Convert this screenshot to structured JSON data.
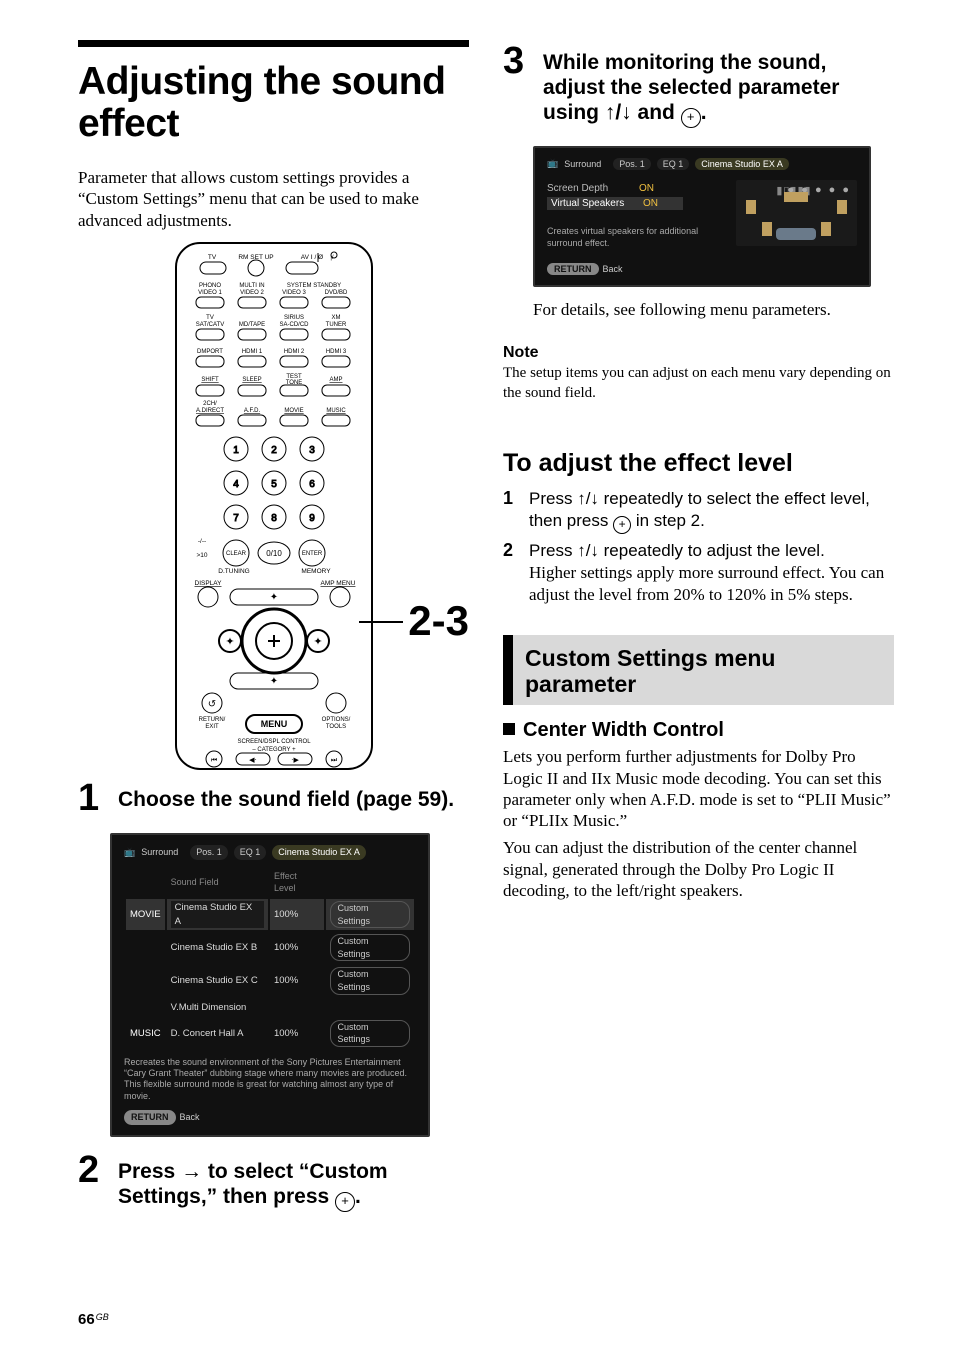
{
  "page_number": "66",
  "page_suffix": "GB",
  "left": {
    "title": "Adjusting the sound effect",
    "intro": "Parameter that allows custom settings provides a “Custom Settings” menu that can be used to make advanced adjustments.",
    "figure_callout": "2-3",
    "remote_labels": {
      "top_row": [
        "TV",
        "RM SET UP",
        "AV Ⅰ / Ø",
        "Ⅰ / Ⅰ"
      ],
      "row2": [
        "PHONO",
        "MULTI IN",
        "SYSTEM STANDBY"
      ],
      "row2b": [
        "VIDEO 1",
        "VIDEO 2",
        "VIDEO 3",
        "DVD/BD"
      ],
      "row3a": [
        "TV",
        "",
        "SIRIUS",
        "XM"
      ],
      "row3b": [
        "SAT/CATV",
        "MD/TAPE",
        "SA-CD/CD",
        "TUNER"
      ],
      "row4": [
        "DMPORT",
        "HDMI 1",
        "HDMI 2",
        "HDMI 3"
      ],
      "row5": [
        "SHIFT",
        "SLEEP",
        "TEST TONE",
        "AMP"
      ],
      "row6a": [
        "2CH/",
        "",
        "",
        ""
      ],
      "row6b": [
        "A.DIRECT",
        "A.F.D.",
        "MOVIE",
        "MUSIC"
      ],
      "num_side": [
        ">10",
        "CLEAR",
        "0/10",
        "ENTER"
      ],
      "below_num": [
        "D.TUNING",
        "",
        "",
        "MEMORY"
      ],
      "disp_row": [
        "DISPLAY",
        "",
        "",
        "AMP MENU"
      ],
      "bottom": [
        "RETURN/ EXIT",
        "MENU",
        "OPTIONS/ TOOLS"
      ],
      "very_bottom1": "SCREEN/DSPL CONTROL",
      "very_bottom2": "–  CATEGORY  +"
    },
    "steps": [
      {
        "num": "1",
        "text": "Choose the sound field (page 59)."
      },
      {
        "num": "2",
        "text_pre": "Press ",
        "arrow": "→",
        "text_mid": " to select “Custom Settings,” then press ",
        "plus": "+",
        "text_post": "."
      }
    ],
    "menu": {
      "crumbs": [
        "Surround",
        "Pos. 1",
        "EQ 1",
        "Cinema Studio EX A"
      ],
      "headers": [
        "",
        "Sound Field",
        "Effect Level",
        ""
      ],
      "rows": [
        {
          "cat": "MOVIE",
          "name": "Cinema Studio EX A",
          "level": "100%",
          "btn": "Custom Settings",
          "highlight": true
        },
        {
          "cat": "",
          "name": "Cinema Studio EX B",
          "level": "100%",
          "btn": "Custom Settings"
        },
        {
          "cat": "",
          "name": "Cinema Studio EX C",
          "level": "100%",
          "btn": "Custom Settings"
        },
        {
          "cat": "",
          "name": "V.Multi Dimension",
          "level": "",
          "btn": ""
        },
        {
          "cat": "MUSIC",
          "name": "D. Concert Hall A",
          "level": "100%",
          "btn": "Custom Settings"
        }
      ],
      "desc": "Recreates the sound environment of the Sony Pictures Entertainment “Cary Grant Theater” dubbing stage where many movies are produced. This flexible surround mode is great for watching almost any type of movie.",
      "return_label": "RETURN",
      "return_text": "Back"
    }
  },
  "right": {
    "step3": {
      "num": "3",
      "text_pre": "While monitoring the sound, adjust the selected parameter using ",
      "arrows": "↑/↓",
      "text_mid": " and ",
      "plus": "+",
      "text_post": "."
    },
    "param_menu": {
      "crumbs": [
        "Surround",
        "Pos. 1",
        "EQ 1",
        "Cinema Studio EX A"
      ],
      "rows": [
        {
          "label": "Screen Depth",
          "value": "ON"
        },
        {
          "label": "Virtual Speakers",
          "value": "ON",
          "highlight": true
        }
      ],
      "desc": "Creates virtual speakers for additional surround effect.",
      "return_label": "RETURN",
      "return_text": "Back"
    },
    "after_param": "For details, see following menu parameters.",
    "note_head": "Note",
    "note_body": "The setup items you can adjust on each menu vary depending on the sound field.",
    "effect_title": "To adjust the effect level",
    "effect_steps": [
      {
        "n": "1",
        "lead_pre": "Press ",
        "arrows": "↑/↓",
        "lead_mid": " repeatedly to select the effect level, then press ",
        "plus": "+",
        "lead_post": " in step 2."
      },
      {
        "n": "2",
        "lead_pre": "Press ",
        "arrows": "↑/↓",
        "lead_mid": " repeatedly to adjust the level.",
        "extra": "Higher settings apply more surround effect. You can adjust the level from 20% to 120% in 5% steps."
      }
    ],
    "custom_header": "Custom Settings menu parameter",
    "sub_item_title": "Center Width Control",
    "sub_item_body1": "Lets you perform further adjustments for Dolby Pro Logic II and IIx Music mode decoding. You can set this parameter only when A.F.D. mode is set to “PLII Music” or “PLIIx Music.”",
    "sub_item_body2": "You can adjust the distribution of the center channel signal, generated through the Dolby Pro Logic II decoding, to the left/right speakers."
  }
}
